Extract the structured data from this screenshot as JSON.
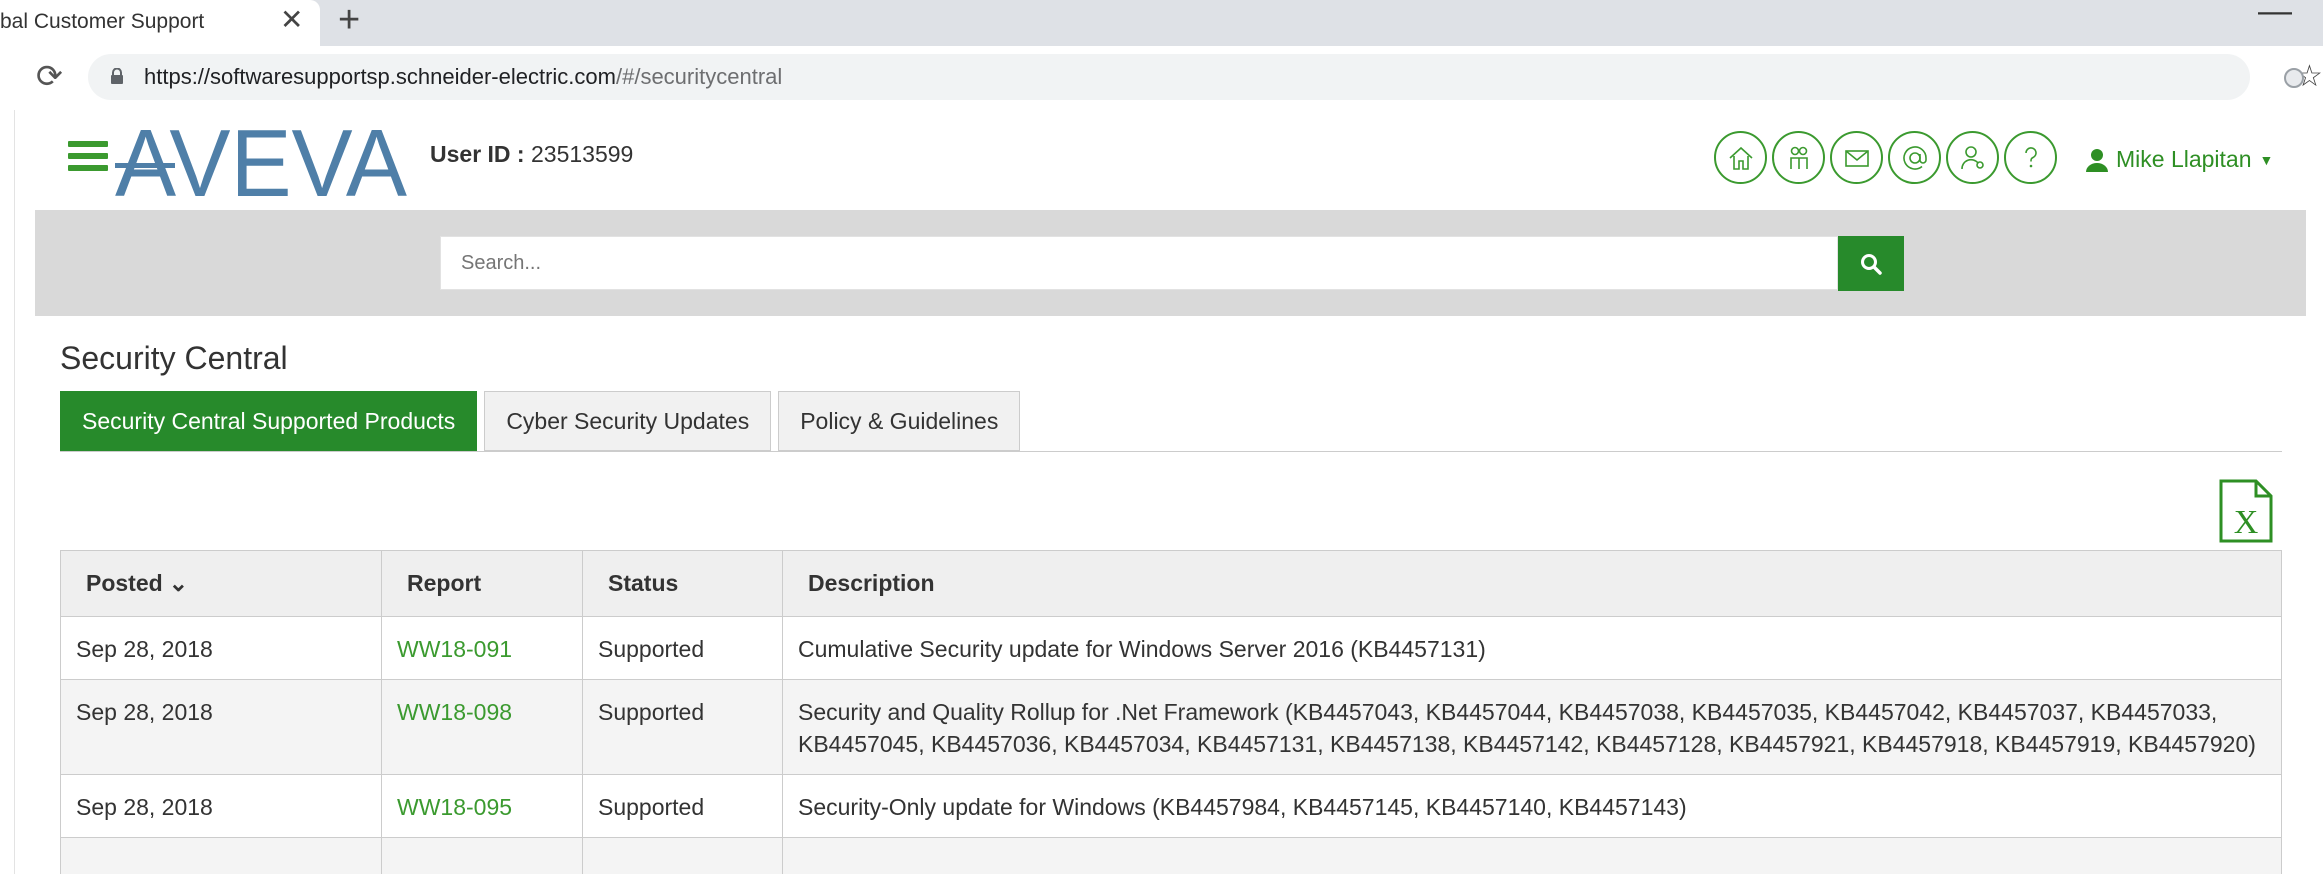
{
  "browser": {
    "tab_title": "bal Customer Support",
    "tab_close": "✕",
    "new_tab": "+",
    "url_host": "https://softwaresupportsp.schneider-electric.com",
    "url_path": "/#/securitycentral"
  },
  "header": {
    "logo_text": "AVEVA",
    "user_id_label": "User ID :",
    "user_id_value": "23513599",
    "icons": [
      "home-icon",
      "community-icon",
      "mail-icon",
      "at-icon",
      "user-admin-icon",
      "help-icon"
    ],
    "user_name": "Mike Llapitan"
  },
  "search": {
    "placeholder": "Search..."
  },
  "main": {
    "title": "Security Central",
    "tabs": [
      {
        "label": "Security Central Supported Products",
        "active": true
      },
      {
        "label": "Cyber Security Updates",
        "active": false
      },
      {
        "label": "Policy & Guidelines",
        "active": false
      }
    ],
    "table": {
      "headers": [
        "Posted",
        "Report",
        "Status",
        "Description"
      ],
      "rows": [
        {
          "posted": "Sep 28, 2018",
          "report": "WW18-091",
          "status": "Supported",
          "description": "Cumulative Security update for Windows Server 2016 (KB4457131)"
        },
        {
          "posted": "Sep 28, 2018",
          "report": "WW18-098",
          "status": "Supported",
          "description": "Security and Quality Rollup for .Net Framework (KB4457043, KB4457044, KB4457038, KB4457035, KB4457042, KB4457037, KB4457033, KB4457045, KB4457036, KB4457034, KB4457131, KB4457138, KB4457142, KB4457128, KB4457921, KB4457918, KB4457919, KB4457920)"
        },
        {
          "posted": "Sep 28, 2018",
          "report": "WW18-095",
          "status": "Supported",
          "description": "Security-Only update for Windows (KB4457984, KB4457145, KB4457140, KB4457143)"
        }
      ]
    }
  },
  "colors": {
    "brand_green": "#278a2b",
    "logo_blue": "#4f7fa8"
  }
}
